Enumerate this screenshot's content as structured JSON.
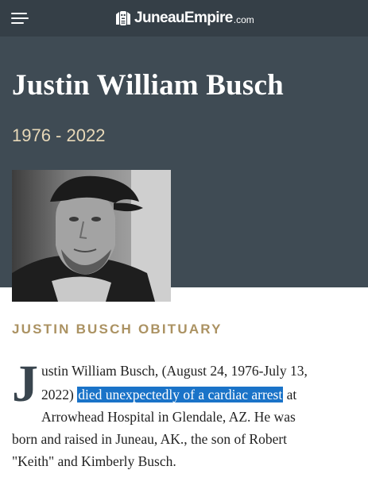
{
  "site": {
    "logo_name": "JuneauEmpire",
    "logo_tld": ".com"
  },
  "obituary": {
    "name": "Justin William Busch",
    "years": "1976 - 2022",
    "section_heading": "JUSTIN BUSCH OBITUARY",
    "dropcap": "J",
    "line1": "ustin William Busch, (August 24, 1976-July 13,",
    "line2_before": "2022)",
    "line2_highlight": "died unexpectedly of a cardiac arrest",
    "line2_after": "at",
    "line3": "Arrowhead Hospital in Glendale, AZ.  He was",
    "line4": "born and raised in Juneau, AK., the son of Robert",
    "line5": "\"Keith\" and Kimberly Busch."
  },
  "colors": {
    "topbar": "#353f47",
    "hero": "#3f4b54",
    "years": "#e7d8b8",
    "heading": "#ab9262",
    "highlight": "#1a73c8"
  },
  "icons": {
    "menu": "hamburger-menu-icon",
    "logo_mark": "totem-logo-icon"
  }
}
